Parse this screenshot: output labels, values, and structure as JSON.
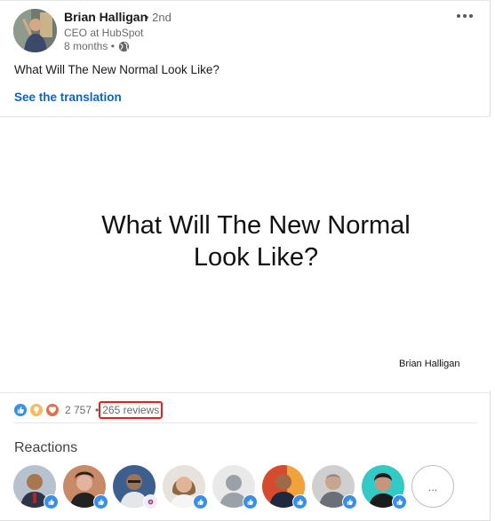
{
  "post": {
    "author_name": "Brian Halligan",
    "connection_degree": "• 2nd",
    "headline": "CEO at HubSpot",
    "time_ago": "8 months •",
    "text": "What Will The New Normal Look Like?",
    "translation_link": "See the translation"
  },
  "media": {
    "title_line1": "What Will The New Normal",
    "title_line2": "Look Like?",
    "author": "Brian Halligan"
  },
  "social": {
    "reaction_count": "2 757",
    "separator": "•",
    "reviews": "265 reviews",
    "reaction_icons": [
      "like-reaction-icon",
      "insightful-reaction-icon",
      "love-reaction-icon"
    ]
  },
  "reactions": {
    "title": "Reactions",
    "more_label": "..."
  },
  "colors": {
    "link_blue": "#0a66c2",
    "like_blue": "#378fe9",
    "insightful_yellow": "#f5bb5c",
    "love_red": "#df704d",
    "highlight_red": "#e0201f"
  }
}
